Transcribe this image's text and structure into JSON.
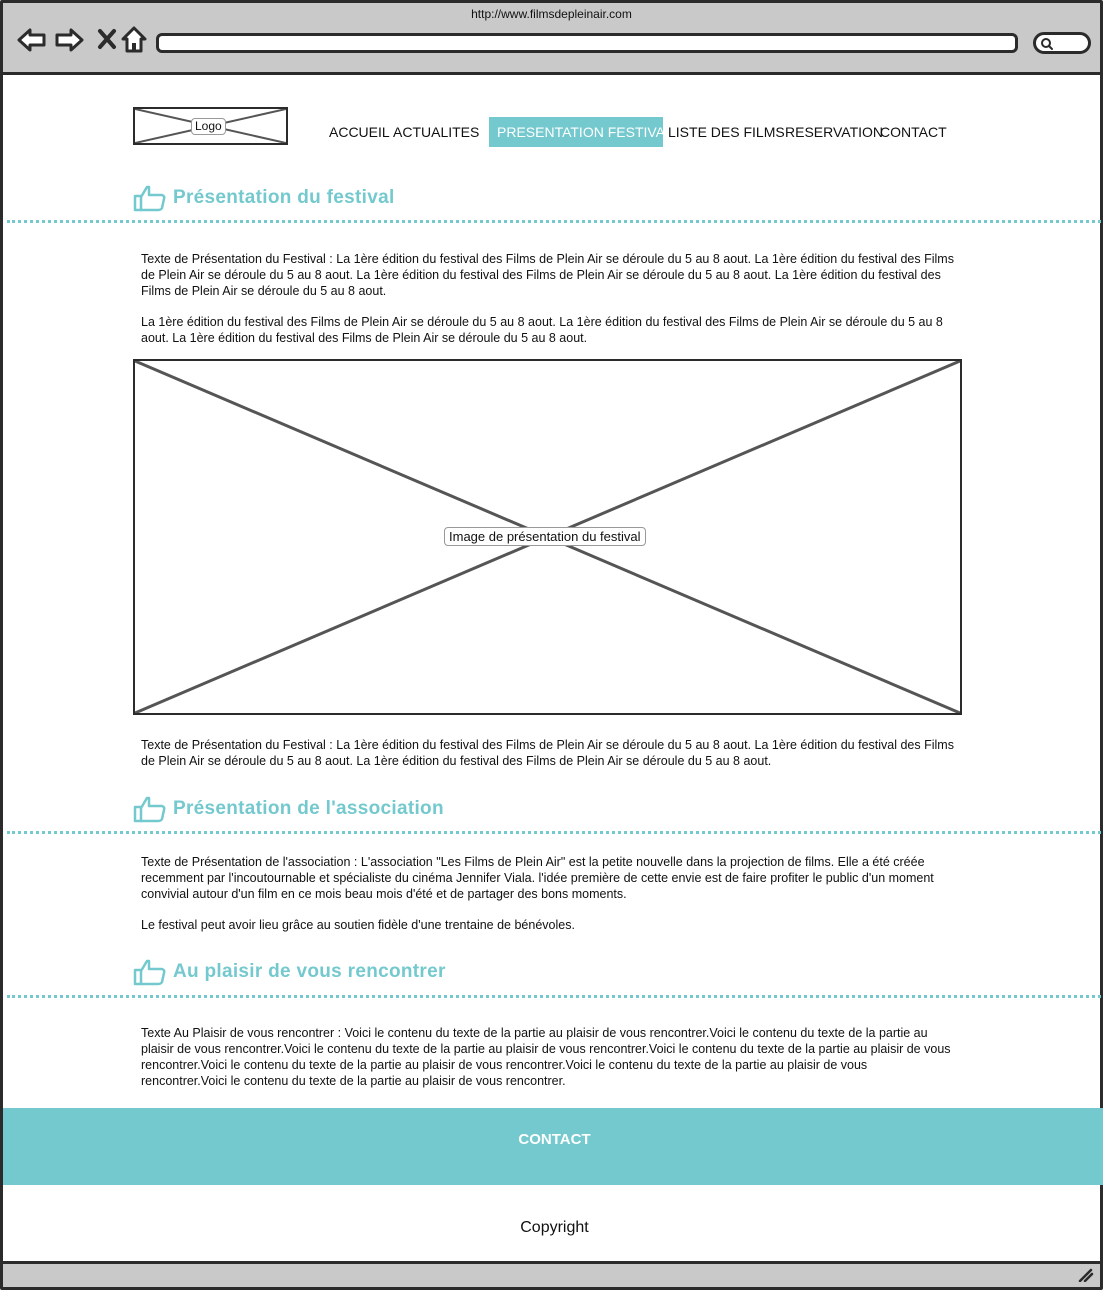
{
  "browser": {
    "url": "http://www.filmsdepleinair.com",
    "icons": [
      "back-arrow-icon",
      "forward-arrow-icon",
      "close-icon",
      "home-icon",
      "search-icon",
      "resize-grip-icon"
    ]
  },
  "header": {
    "logo_label": "Logo",
    "nav": [
      {
        "label": "ACCUEIL"
      },
      {
        "label": "ACTUALITES"
      },
      {
        "label": "PRESENTATION FESTIVAL",
        "active": true
      },
      {
        "label": "LISTE DES FILMS"
      },
      {
        "label": "RESERVATION"
      },
      {
        "label": "CONTACT"
      }
    ]
  },
  "colors": {
    "accent": "#74c9ce",
    "ink": "#2b2b2b",
    "chrome": "#c9c9c9"
  },
  "sections": {
    "festival": {
      "title": "Présentation du festival",
      "p1": "Texte de Présentation du Festival : La 1ère édition du festival des Films de Plein Air se déroule du 5 au 8 aout. La 1ère édition du festival des Films de Plein Air se déroule du 5 au 8 aout. La 1ère édition du festival des Films de Plein Air se déroule du 5 au 8 aout. La 1ère édition du festival des Films de Plein Air se déroule du 5 au 8 aout.",
      "p2": "La 1ère édition du festival des Films de Plein Air se déroule du 5 au 8 aout. La 1ère édition du festival des Films de Plein Air se déroule du 5 au 8 aout. La 1ère édition du festival des Films de Plein Air se déroule du 5 au 8 aout.",
      "image_label": "Image de présentation du festival",
      "p3": "Texte de Présentation du Festival : La 1ère édition du festival des Films de Plein Air se déroule du 5 au 8 aout. La 1ère édition du festival des Films de Plein Air se déroule du 5 au 8 aout. La 1ère édition du festival des Films de Plein Air se déroule du 5 au 8 aout."
    },
    "association": {
      "title": "Présentation de l'association",
      "p1": "Texte de Présentation de l'association : L'association \"Les Films de Plein Air\" est la petite nouvelle dans la projection de films. Elle a été créée recemment par l'incoutournable et spécialiste du cinéma Jennifer Viala. l'idée première de cette envie est de faire profiter le public d'un moment convivial autour d'un film en ce mois beau mois d'été et de partager des bons moments.",
      "p2": "Le festival peut avoir lieu grâce au soutien fidèle d'une trentaine de bénévoles."
    },
    "plaisir": {
      "title": "Au plaisir de vous rencontrer",
      "p1": "Texte Au Plaisir de vous rencontrer : Voici le contenu du texte de la partie au plaisir de vous rencontrer.Voici le contenu du texte de la partie au plaisir de vous rencontrer.Voici le contenu du texte de la partie au plaisir de vous rencontrer.Voici le contenu du texte de la partie au plaisir de vous rencontrer.Voici le contenu du texte de la partie au plaisir de vous rencontrer.Voici le contenu du texte de la partie au plaisir de vous rencontrer.Voici le contenu du texte de la partie au plaisir de vous rencontrer."
    }
  },
  "footer": {
    "contact_label": "CONTACT",
    "copyright": "Copyright"
  }
}
